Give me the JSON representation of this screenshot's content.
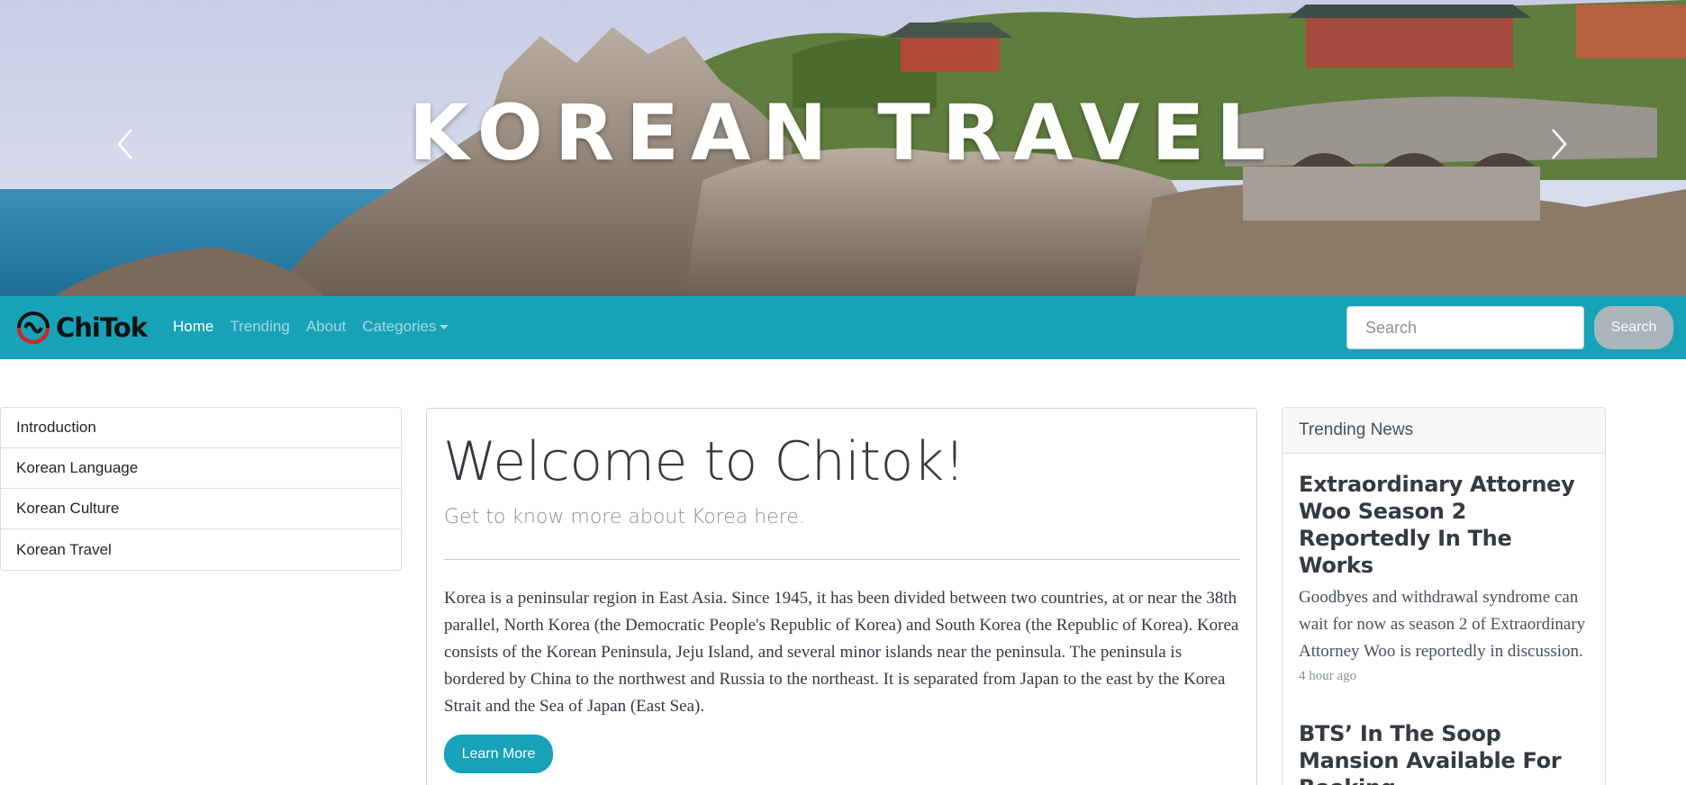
{
  "hero": {
    "title": "KOREAN TRAVEL"
  },
  "navbar": {
    "brand": "ChiTok",
    "links": [
      {
        "label": "Home"
      },
      {
        "label": "Trending"
      },
      {
        "label": "About"
      },
      {
        "label": "Categories"
      }
    ],
    "search_placeholder": "Search",
    "search_button": "Search"
  },
  "sidebar": {
    "items": [
      {
        "label": "Introduction"
      },
      {
        "label": "Korean Language"
      },
      {
        "label": "Korean Culture"
      },
      {
        "label": "Korean Travel"
      }
    ]
  },
  "main": {
    "heading": "Welcome to Chitok!",
    "subheading": "Get to know more about Korea here.",
    "body": "Korea is a peninsular region in East Asia. Since 1945, it has been divided between two countries, at or near the 38th parallel, North Korea (the Democratic People's Republic of Korea) and South Korea (the Republic of Korea). Korea consists of the Korean Peninsula, Jeju Island, and several minor islands near the peninsula. The peninsula is bordered by China to the northwest and Russia to the northeast. It is separated from Japan to the east by the Korea Strait and the Sea of Japan (East Sea).",
    "button": "Learn More"
  },
  "trending": {
    "header": "Trending News",
    "items": [
      {
        "title": "Extraordinary Attorney Woo Season 2 Reportedly In The Works",
        "description": "Goodbyes and withdrawal syndrome can wait for now as season 2 of Extraordinary Attorney Woo is reportedly in discussion.",
        "time": "4 hour ago"
      },
      {
        "title": "BTS’ In The Soop Mansion Available For Booking"
      }
    ]
  },
  "colors": {
    "navbar": "#17a2b8",
    "button": "#17a2b8",
    "search_button": "#a9b4bb"
  }
}
